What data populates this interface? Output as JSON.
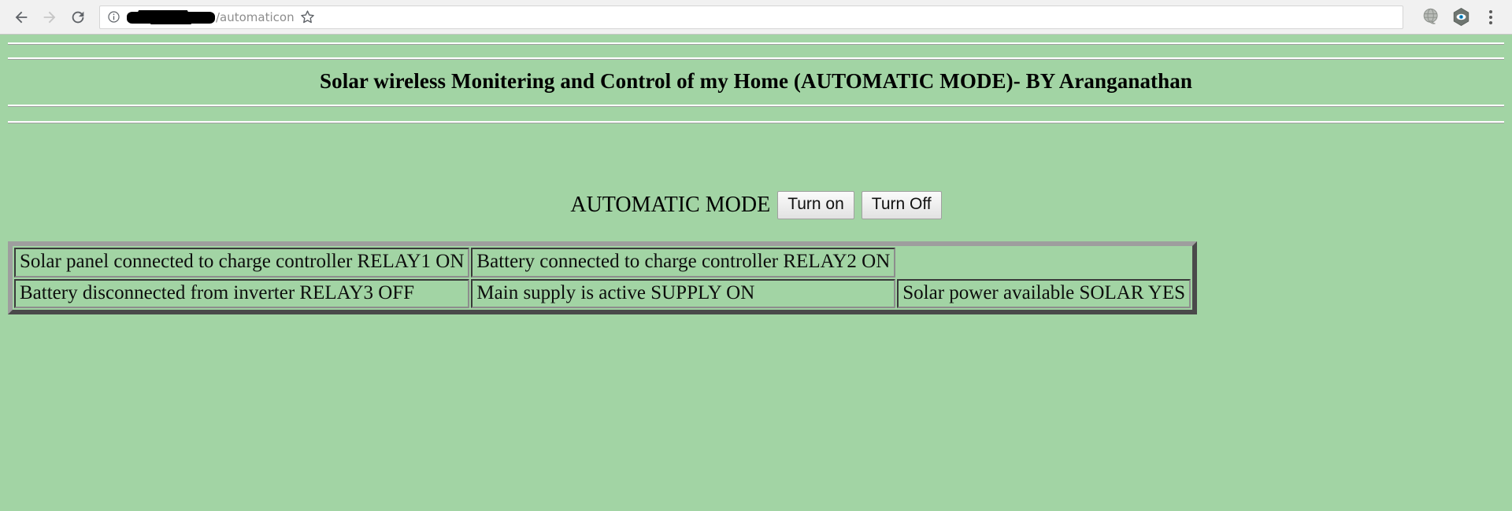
{
  "browser": {
    "back_label": "Back",
    "forward_label": "Forward",
    "reload_label": "Reload",
    "info_icon_label": "Site information",
    "url_host_redacted": "",
    "url_path": "/automaticon",
    "bookmark_label": "Bookmark this page",
    "extension_one_label": "extension-globe",
    "extension_two_label": "extension-eye",
    "menu_label": "Customize and control Google Chrome"
  },
  "page": {
    "title": "Solar wireless Monitering and Control of my Home (AUTOMATIC MODE)- BY Aranganathan",
    "background_color": "#a2d4a4",
    "mode": {
      "label": "AUTOMATIC MODE",
      "turn_on_label": "Turn on",
      "turn_off_label": "Turn Off"
    },
    "status_table": {
      "rows": [
        [
          "Solar panel connected to charge controller RELAY1 ON",
          "Battery connected to charge controller RELAY2 ON",
          ""
        ],
        [
          "Battery disconnected from inverter RELAY3 OFF",
          "Main supply is active SUPPLY ON",
          "Solar power available SOLAR YES"
        ]
      ]
    }
  }
}
